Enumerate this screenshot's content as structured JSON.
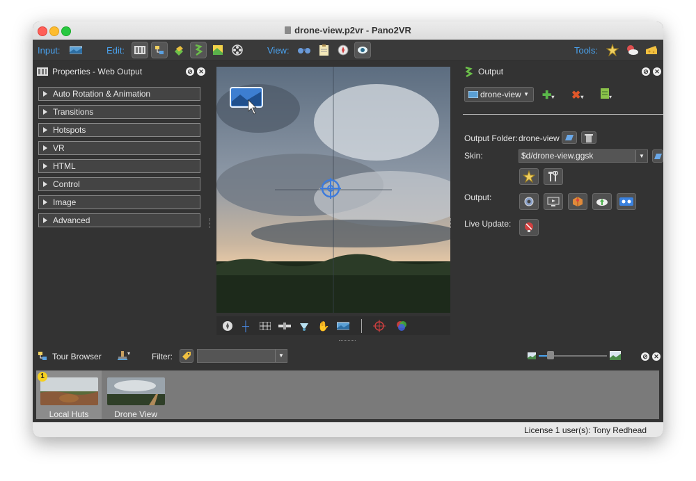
{
  "window": {
    "title": "drone-view.p2vr - Pano2VR"
  },
  "toolbar": {
    "input_label": "Input:",
    "edit_label": "Edit:",
    "view_label": "View:",
    "tools_label": "Tools:",
    "icons": [
      "input-pano-icon",
      "edit-viewing-parameters-icon",
      "edit-hotspots-icon",
      "edit-patches-icon",
      "edit-tour-icon",
      "edit-maps-icon",
      "edit-media-icon",
      "view-binoculars-icon",
      "view-notes-icon",
      "view-compass-icon",
      "view-eye-icon",
      "tools-star-icon",
      "tools-weather-icon",
      "tools-cheese-icon"
    ]
  },
  "left_panel": {
    "title": "Properties - Web Output",
    "sections": [
      "Auto Rotation & Animation",
      "Transitions",
      "Hotspots",
      "VR",
      "HTML",
      "Control",
      "Image",
      "Advanced"
    ]
  },
  "viewer": {
    "tools": [
      "compass-icon",
      "crosshair-icon",
      "grid-icon",
      "level-icon",
      "spotlight-icon",
      "hand-icon",
      "panorama-icon",
      "target-icon",
      "color-wheel-icon"
    ]
  },
  "right_panel": {
    "title": "Output",
    "output_select": "drone-view",
    "output_folder_label": "Output Folder:",
    "output_folder_value": "drone-view",
    "skin_label": "Skin:",
    "skin_value": "$d/drone-view.ggsk",
    "output_label": "Output:",
    "live_update_label": "Live Update:"
  },
  "tour_browser": {
    "title": "Tour Browser",
    "filter_label": "Filter:",
    "filter_value": "",
    "items": [
      {
        "caption": "Local Huts",
        "badge": "1",
        "selected": true
      },
      {
        "caption": "Drone View",
        "badge": "",
        "selected": false
      }
    ]
  },
  "status": {
    "license_text": "License 1 user(s): Tony Redhead"
  },
  "colors": {
    "accent": "#4aa3f0",
    "background": "#333333",
    "selection": "#8c8c8c"
  }
}
